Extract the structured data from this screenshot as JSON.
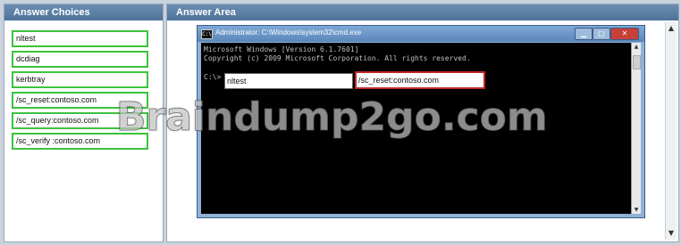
{
  "answer_choices": {
    "header": "Answer Choices",
    "items": [
      "nltest",
      "dcdiag",
      "kerbtray",
      "/sc_reset:contoso.com",
      "/sc_query:contoso.com",
      "/sc_verify :contoso.com"
    ]
  },
  "answer_area": {
    "header": "Answer Area"
  },
  "cmd_window": {
    "title": "Administrator: C:\\Windows\\system32\\cmd.exe",
    "icon_name": "cmd-icon",
    "console_line_1": "Microsoft Windows [Version 6.1.7601]",
    "console_line_2": "Copyright (c) 2009 Microsoft Corporation.  All rights reserved.",
    "prompt": "C:\\>",
    "drop_box_1": "nltest",
    "drop_box_2": "/sc_reset:contoso.com"
  },
  "watermark": "Braindump2go.com",
  "colors": {
    "header_bg": "#5a7fa6",
    "choice_border": "#3cc23c",
    "selected_border": "#c0282a"
  }
}
